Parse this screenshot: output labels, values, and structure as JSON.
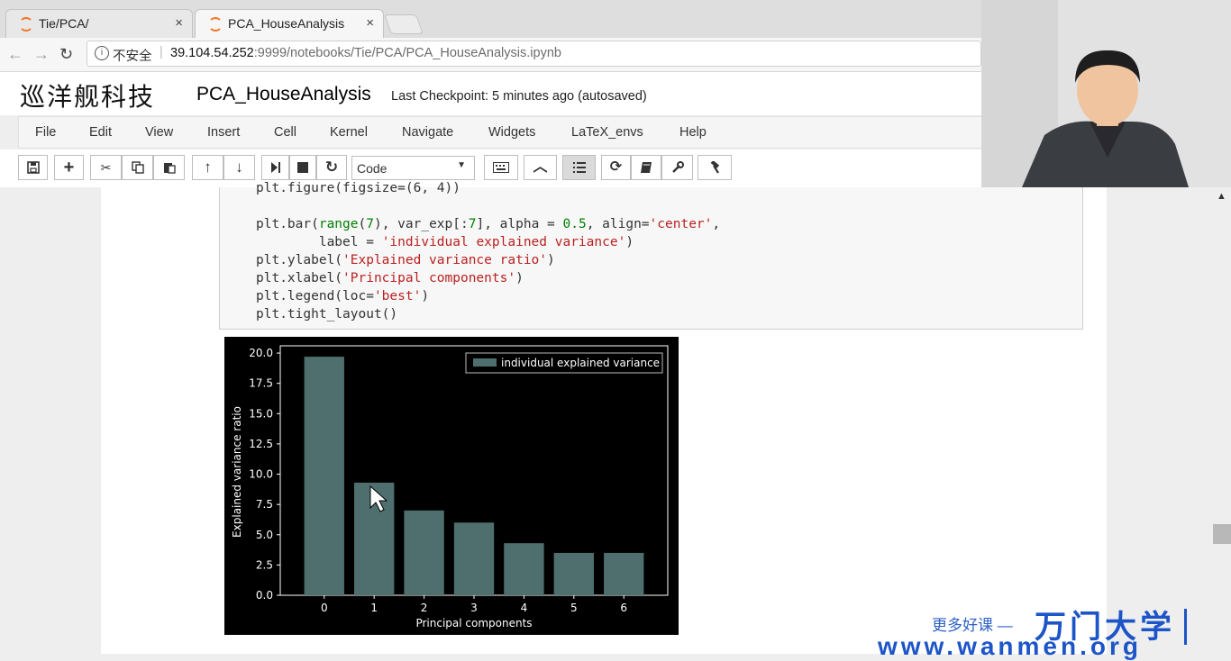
{
  "browser": {
    "tabs": [
      {
        "title": "Tie/PCA/",
        "close": "×"
      },
      {
        "title": "PCA_HouseAnalysis",
        "close": "×"
      }
    ],
    "insecure_label": "不安全",
    "url_host": "39.104.54.252",
    "url_path": ":9999/notebooks/Tie/PCA/PCA_HouseAnalysis.ipynb"
  },
  "header": {
    "logo_text": "巡洋舰科技",
    "notebook_name": "PCA_HouseAnalysis",
    "checkpoint": "Last Checkpoint: 5 minutes ago (autosaved)"
  },
  "menu": [
    "File",
    "Edit",
    "View",
    "Insert",
    "Cell",
    "Kernel",
    "Navigate",
    "Widgets",
    "LaTeX_envs",
    "Help"
  ],
  "toolbar": {
    "cell_type": "Code",
    "icons": [
      "save-icon",
      "plus-icon",
      "scissors-icon",
      "copy-icon",
      "paste-icon",
      "arrow-up-icon",
      "arrow-down-icon",
      "run-step-icon",
      "stop-icon",
      "restart-icon",
      "keyboard-icon",
      "chevron-up-icon",
      "list-icon",
      "refresh-icon",
      "book-icon",
      "wrench-icon",
      "hammer-icon"
    ]
  },
  "code_cell": {
    "lines": [
      "plt.figure(figsize=(6, 4))",
      "",
      "plt.bar(range(7), var_exp[:7], alpha = 0.5, align='center',",
      "        label = 'individual explained variance')",
      "plt.ylabel('Explained variance ratio')",
      "plt.xlabel('Principal components')",
      "plt.legend(loc='best')",
      "plt.tight_layout()"
    ]
  },
  "chart_data": {
    "type": "bar",
    "categories": [
      "0",
      "1",
      "2",
      "3",
      "4",
      "5",
      "6"
    ],
    "series": [
      {
        "name": "individual explained variance",
        "values": [
          19.7,
          9.3,
          7.0,
          6.0,
          4.3,
          3.5,
          3.5
        ]
      }
    ],
    "xlabel": "Principal components",
    "ylabel": "Explained variance ratio",
    "ylim": [
      0,
      20.6
    ],
    "yticks": [
      "0.0",
      "2.5",
      "5.0",
      "7.5",
      "10.0",
      "12.5",
      "15.0",
      "17.5",
      "20.0"
    ],
    "legend": "top-right",
    "grid": false,
    "bar_color": "#4f6f6f",
    "background": "#000000"
  },
  "watermark": {
    "prefix": "更多好课 —",
    "brand": "万门大学",
    "url": "www.wanmen.org"
  }
}
